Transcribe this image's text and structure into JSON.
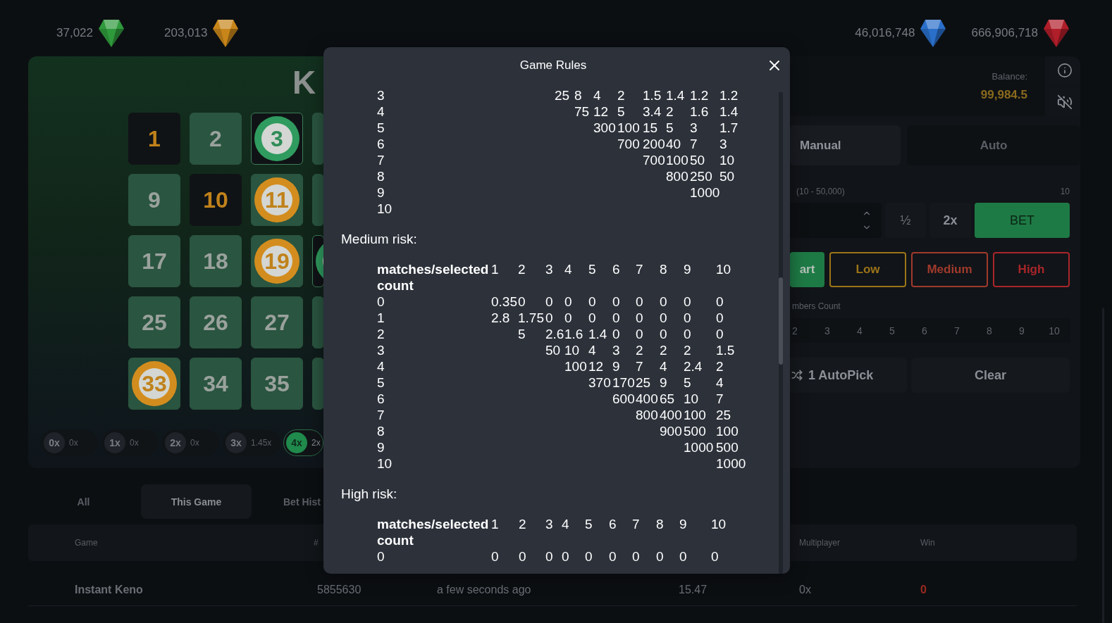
{
  "top_bar": {
    "left": [
      {
        "value": "37,022",
        "color": "#2f9a3c"
      },
      {
        "value": "203,013",
        "color": "#c8861a"
      }
    ],
    "right": [
      {
        "value": "46,016,748",
        "color": "#2a6fc9"
      },
      {
        "value": "666,906,718",
        "color": "#b01e2a"
      }
    ]
  },
  "board": {
    "title": "K",
    "tiles": [
      {
        "number": "1",
        "selected": true,
        "drawn": false
      },
      {
        "number": "2",
        "selected": false,
        "drawn": false
      },
      {
        "number": "3",
        "selected": true,
        "drawn": true
      },
      {
        "selected": false,
        "drawn": false
      },
      {
        "number": "9",
        "selected": false,
        "drawn": false
      },
      {
        "number": "10",
        "selected": true,
        "drawn": false
      },
      {
        "number": "11",
        "selected": false,
        "drawn": true
      },
      {
        "selected": false,
        "drawn": false
      },
      {
        "number": "17",
        "selected": false,
        "drawn": false
      },
      {
        "number": "18",
        "selected": false,
        "drawn": false
      },
      {
        "number": "19",
        "selected": false,
        "drawn": true
      },
      {
        "selected": true,
        "drawn": true
      },
      {
        "number": "25",
        "selected": false,
        "drawn": false
      },
      {
        "number": "26",
        "selected": false,
        "drawn": false
      },
      {
        "number": "27",
        "selected": false,
        "drawn": false
      },
      {
        "selected": false,
        "drawn": false
      },
      {
        "number": "33",
        "selected": false,
        "drawn": true
      },
      {
        "number": "34",
        "selected": false,
        "drawn": false
      },
      {
        "number": "35",
        "selected": false,
        "drawn": false
      },
      {
        "selected": false,
        "drawn": false
      }
    ],
    "multipliers": [
      {
        "multiplier": "0x",
        "payout": "0x",
        "active": false
      },
      {
        "multiplier": "1x",
        "payout": "0x",
        "active": false
      },
      {
        "multiplier": "2x",
        "payout": "0x",
        "active": false
      },
      {
        "multiplier": "3x",
        "payout": "1.45x",
        "active": false
      },
      {
        "multiplier": "4x",
        "payout": "2x",
        "active": true
      }
    ]
  },
  "controls": {
    "balance_label": "Balance:",
    "balance": "99,984.5",
    "tabs": [
      {
        "label": "Manual",
        "selected": true
      },
      {
        "label": "Auto",
        "selected": false
      }
    ],
    "bet": {
      "range_label": "(10 - 50,000)",
      "side_value": "10",
      "half": "½",
      "double": "2x",
      "submit": "BET"
    },
    "risk": [
      {
        "label": "art",
        "selected": true,
        "color": "#1e7a45"
      },
      {
        "label": "Low",
        "selected": false,
        "color": "#9c7418"
      },
      {
        "label": "Medium",
        "selected": false,
        "color": "#a03a2c"
      },
      {
        "label": "High",
        "selected": false,
        "color": "#a8262a"
      }
    ],
    "count_label": "mbers Count",
    "counts": [
      "2",
      "3",
      "4",
      "5",
      "6",
      "7",
      "8",
      "9",
      "10"
    ],
    "autopick": "1 AutoPick",
    "clear": "Clear"
  },
  "history": {
    "tabs": [
      {
        "label": "All",
        "selected": false
      },
      {
        "label": "This Game",
        "selected": true
      },
      {
        "label": "Bet Hist",
        "selected": false
      }
    ],
    "columns": [
      "Game",
      "#",
      "",
      "",
      "Multiplayer",
      "Win"
    ],
    "rows": [
      {
        "cells": [
          "Instant Keno",
          "5855630",
          "a few seconds ago",
          "15.47",
          "0x",
          "0"
        ],
        "won": false
      }
    ]
  },
  "rules": {
    "title": "Game Rules",
    "tables": [
      {
        "rows": [
          {
            "cells": [
              "3",
              "",
              "",
              "25",
              "8",
              "4",
              "2",
              "1.5",
              "1.4",
              "1.2",
              "1.2"
            ]
          },
          {
            "cells": [
              "4",
              "",
              "",
              "",
              "75",
              "12",
              "5",
              "3.4",
              "2",
              "1.6",
              "1.4"
            ]
          },
          {
            "cells": [
              "5",
              "",
              "",
              "",
              "",
              "300",
              "100",
              "15",
              "5",
              "3",
              "1.7"
            ]
          },
          {
            "cells": [
              "6",
              "",
              "",
              "",
              "",
              "",
              "700",
              "200",
              "40",
              "7",
              "3"
            ]
          },
          {
            "cells": [
              "7",
              "",
              "",
              "",
              "",
              "",
              "",
              "700",
              "100",
              "50",
              "10"
            ]
          },
          {
            "cells": [
              "8",
              "",
              "",
              "",
              "",
              "",
              "",
              "",
              "800",
              "250",
              "50"
            ]
          },
          {
            "cells": [
              "9",
              "",
              "",
              "",
              "",
              "",
              "",
              "",
              "",
              "1000"
            ]
          },
          {
            "cells": [
              "10"
            ]
          }
        ]
      },
      {
        "heading": "Medium risk:",
        "columns": [
          "matches/selected count",
          "1",
          "2",
          "3",
          "4",
          "5",
          "6",
          "7",
          "8",
          "9",
          "10"
        ],
        "rows": [
          {
            "cells": [
              "0",
              "0.35",
              "0",
              "0",
              "0",
              "0",
              "0",
              "0",
              "0",
              "0",
              "0"
            ]
          },
          {
            "cells": [
              "1",
              "2.8",
              "1.75",
              "0",
              "0",
              "0",
              "0",
              "0",
              "0",
              "0",
              "0"
            ]
          },
          {
            "cells": [
              "2",
              "",
              "5",
              "2.6",
              "1.6",
              "1.4",
              "0",
              "0",
              "0",
              "0",
              "0"
            ]
          },
          {
            "cells": [
              "3",
              "",
              "",
              "50",
              "10",
              "4",
              "3",
              "2",
              "2",
              "2",
              "1.5"
            ]
          },
          {
            "cells": [
              "4",
              "",
              "",
              "",
              "100",
              "12",
              "9",
              "7",
              "4",
              "2.4",
              "2"
            ]
          },
          {
            "cells": [
              "5",
              "",
              "",
              "",
              "",
              "370",
              "170",
              "25",
              "9",
              "5",
              "4"
            ]
          },
          {
            "cells": [
              "6",
              "",
              "",
              "",
              "",
              "",
              "600",
              "400",
              "65",
              "10",
              "7"
            ]
          },
          {
            "cells": [
              "7",
              "",
              "",
              "",
              "",
              "",
              "",
              "800",
              "400",
              "100",
              "25"
            ]
          },
          {
            "cells": [
              "8",
              "",
              "",
              "",
              "",
              "",
              "",
              "",
              "900",
              "500",
              "100"
            ]
          },
          {
            "cells": [
              "9",
              "",
              "",
              "",
              "",
              "",
              "",
              "",
              "",
              "1000",
              "500"
            ]
          },
          {
            "cells": [
              "10",
              "",
              "",
              "",
              "",
              "",
              "",
              "",
              "",
              "",
              "1000"
            ]
          }
        ]
      },
      {
        "heading": "High risk:",
        "columns": [
          "matches/selected count",
          "1",
          "2",
          "3",
          "4",
          "5",
          "6",
          "7",
          "8",
          "9",
          "10"
        ],
        "rows": [
          {
            "cells": [
              "0",
              "0",
              "0",
              "0",
              "0",
              "0",
              "0",
              "0",
              "0",
              "0",
              "0"
            ]
          }
        ]
      }
    ]
  }
}
